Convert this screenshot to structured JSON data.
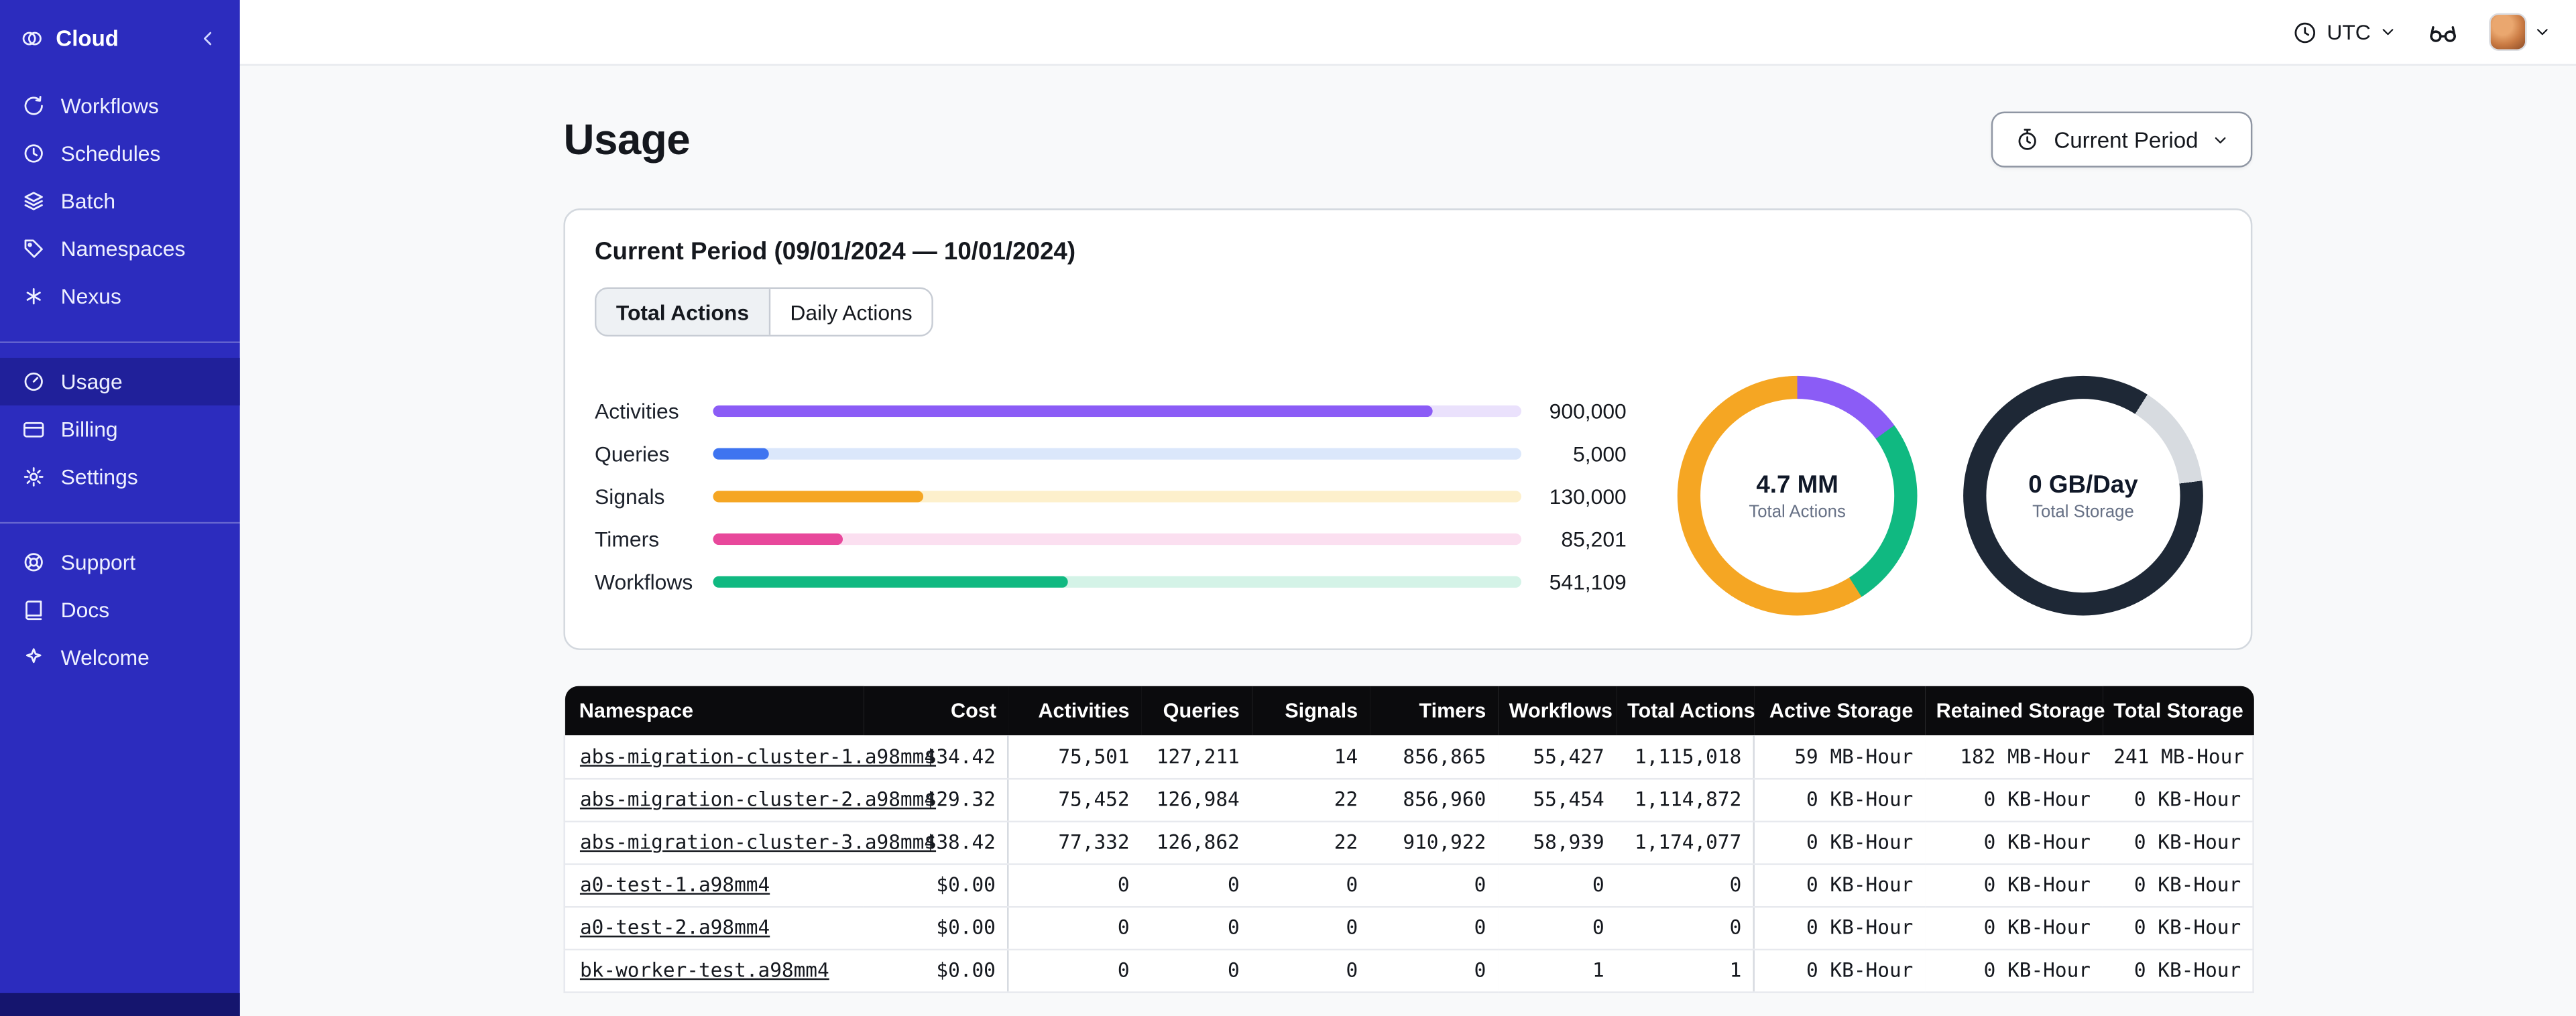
{
  "sidebar": {
    "brand": {
      "label": "Cloud"
    },
    "groups": [
      {
        "items": [
          {
            "label": "Workflows",
            "icon": "workflows-icon"
          },
          {
            "label": "Schedules",
            "icon": "schedules-icon"
          },
          {
            "label": "Batch",
            "icon": "batch-icon"
          },
          {
            "label": "Namespaces",
            "icon": "namespaces-icon"
          },
          {
            "label": "Nexus",
            "icon": "nexus-icon"
          }
        ]
      },
      {
        "items": [
          {
            "label": "Usage",
            "icon": "usage-icon",
            "active": true
          },
          {
            "label": "Billing",
            "icon": "billing-icon"
          },
          {
            "label": "Settings",
            "icon": "settings-icon"
          }
        ]
      },
      {
        "items": [
          {
            "label": "Support",
            "icon": "support-icon"
          },
          {
            "label": "Docs",
            "icon": "docs-icon"
          },
          {
            "label": "Welcome",
            "icon": "welcome-icon"
          }
        ]
      }
    ]
  },
  "topbar": {
    "timezone": "UTC"
  },
  "page": {
    "title": "Usage",
    "period_selector": "Current Period"
  },
  "usage_card": {
    "title": "Current Period (09/01/2024 — 10/01/2024)",
    "tabs": [
      {
        "label": "Total Actions",
        "active": true
      },
      {
        "label": "Daily Actions",
        "active": false
      }
    ]
  },
  "chart_data": [
    {
      "type": "bar",
      "orientation": "horizontal",
      "title": "Total Actions by type",
      "categories": [
        "Activities",
        "Queries",
        "Signals",
        "Timers",
        "Workflows"
      ],
      "values": [
        900000,
        5000,
        130000,
        85201,
        541109
      ],
      "value_labels": [
        "900,000",
        "5,000",
        "130,000",
        "85,201",
        "541,109"
      ],
      "percent_filled": [
        89,
        7,
        26,
        16,
        44
      ],
      "colors": [
        "#8b5cf6",
        "#3e74f0",
        "#f5a623",
        "#e8489b",
        "#10b981"
      ],
      "track_colors": [
        "#eae1fc",
        "#dbe7fb",
        "#fdf0cc",
        "#fbdff0",
        "#d4f3e7"
      ]
    },
    {
      "type": "donut",
      "center_value": "4.7 MM",
      "center_label": "Total Actions",
      "slices": [
        {
          "label": "segment-1",
          "color": "#8b5cf6",
          "percent": 15
        },
        {
          "label": "segment-2",
          "color": "#10b981",
          "percent": 26
        },
        {
          "label": "segment-3",
          "color": "#f5a623",
          "percent": 59
        }
      ]
    },
    {
      "type": "donut",
      "center_value": "0 GB/Day",
      "center_label": "Total Storage",
      "slices": [
        {
          "label": "segment-1",
          "color": "#1e2836",
          "percent": 9
        },
        {
          "label": "segment-2",
          "color": "#d7dbe0",
          "percent": 14
        },
        {
          "label": "segment-3",
          "color": "#1e2836",
          "percent": 77
        }
      ]
    }
  ],
  "table": {
    "headers": [
      "Namespace",
      "Cost",
      "Activities",
      "Queries",
      "Signals",
      "Timers",
      "Workflows",
      "Total Actions",
      "Active Storage",
      "Retained Storage",
      "Total Storage"
    ],
    "rows": [
      [
        "abs-migration-cluster-1.a98mm4",
        "$34.42",
        "75,501",
        "127,211",
        "14",
        "856,865",
        "55,427",
        "1,115,018",
        "59 MB-Hour",
        "182 MB-Hour",
        "241 MB-Hour"
      ],
      [
        "abs-migration-cluster-2.a98mm4",
        "$29.32",
        "75,452",
        "126,984",
        "22",
        "856,960",
        "55,454",
        "1,114,872",
        "0 KB-Hour",
        "0 KB-Hour",
        "0 KB-Hour"
      ],
      [
        "abs-migration-cluster-3.a98mm4",
        "$38.42",
        "77,332",
        "126,862",
        "22",
        "910,922",
        "58,939",
        "1,174,077",
        "0 KB-Hour",
        "0 KB-Hour",
        "0 KB-Hour"
      ],
      [
        "a0-test-1.a98mm4",
        "$0.00",
        "0",
        "0",
        "0",
        "0",
        "0",
        "0",
        "0 KB-Hour",
        "0 KB-Hour",
        "0 KB-Hour"
      ],
      [
        "a0-test-2.a98mm4",
        "$0.00",
        "0",
        "0",
        "0",
        "0",
        "0",
        "0",
        "0 KB-Hour",
        "0 KB-Hour",
        "0 KB-Hour"
      ],
      [
        "bk-worker-test.a98mm4",
        "$0.00",
        "0",
        "0",
        "0",
        "0",
        "1",
        "1",
        "0 KB-Hour",
        "0 KB-Hour",
        "0 KB-Hour"
      ]
    ]
  },
  "colors": {
    "sidebar_bg": "#2c2cbe",
    "sidebar_active_bg": "#20209a",
    "table_header_bg": "#0b0b0d",
    "accent_purple": "#8b5cf6",
    "accent_blue": "#3e74f0",
    "accent_orange": "#f5a623",
    "accent_pink": "#e8489b",
    "accent_green": "#10b981",
    "storage_ring_dark": "#1e2836"
  }
}
